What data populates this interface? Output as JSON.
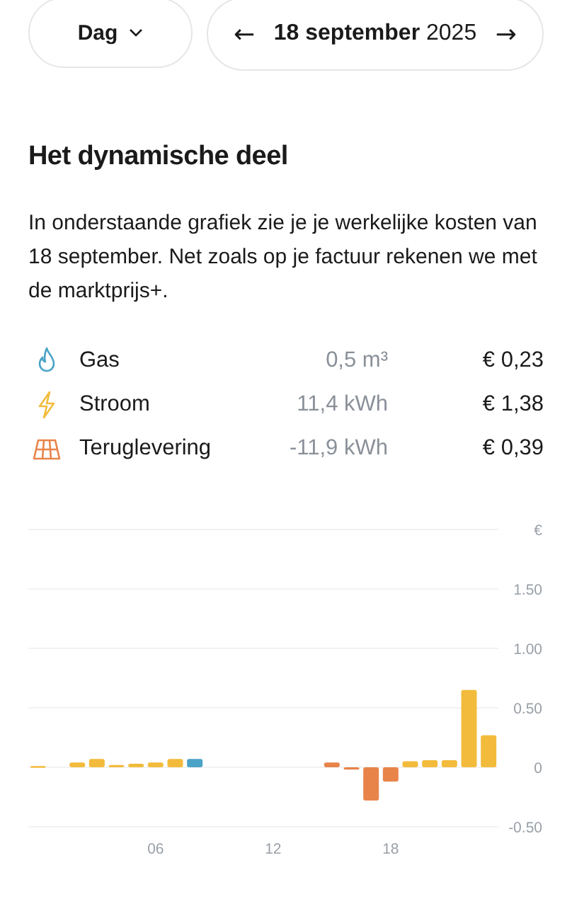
{
  "period_selector": {
    "label": "Dag"
  },
  "date_nav": {
    "date_bold": "18 september",
    "year": "2025",
    "prev": "←",
    "next": "→"
  },
  "section": {
    "title": "Het dynamische deel",
    "text": "In onderstaande grafiek zie je je werkelijke kosten van 18 september. Net zoals op je factuur rekenen we met de marktprijs+."
  },
  "costs": [
    {
      "kind": "gas",
      "name": "Gas",
      "usage": "0,5 m³",
      "cost": "€ 0,23"
    },
    {
      "kind": "stroom",
      "name": "Stroom",
      "usage": "11,4 kWh",
      "cost": "€ 1,38"
    },
    {
      "kind": "teruglevering",
      "name": "Teruglevering",
      "usage": "-11,9 kWh",
      "cost": "€ 0,39"
    }
  ],
  "chart": {
    "chart_data": {
      "type": "bar",
      "grid": true,
      "ylabel": "€",
      "xlim": [
        -0.5,
        23.5
      ],
      "x": [
        0,
        1,
        2,
        3,
        4,
        5,
        6,
        7,
        8,
        9,
        10,
        11,
        12,
        13,
        14,
        15,
        16,
        17,
        18,
        19,
        20,
        21,
        22,
        23
      ],
      "series": [
        {
          "color": "#f2bb3c",
          "values": [
            0.01,
            0,
            0.04,
            0.07,
            0.02,
            0.03,
            0.04,
            0.07,
            0,
            0,
            0,
            0,
            0,
            0,
            0,
            0,
            0,
            0,
            0,
            0.05,
            0.06,
            0.06,
            0.65,
            0.27
          ]
        },
        {
          "color": "#4aa3c6",
          "values": [
            0,
            0,
            0,
            0,
            0,
            0,
            0,
            0,
            0.07,
            0,
            0,
            0,
            0,
            0,
            0,
            0,
            0,
            0,
            0,
            0,
            0,
            0,
            0,
            0
          ]
        },
        {
          "color": "#e8844a",
          "values": [
            0,
            0,
            0,
            0,
            0,
            0,
            0,
            0,
            0,
            0,
            0,
            0,
            0,
            0,
            0,
            0.04,
            -0.02,
            -0.28,
            -0.12,
            0,
            0,
            0,
            0,
            0
          ]
        }
      ],
      "ylim": [
        -0.5,
        2.0
      ],
      "yticks": [
        {
          "value": -0.5,
          "label": "-0.50"
        },
        {
          "value": 0,
          "label": "0"
        },
        {
          "value": 0.5,
          "label": "0.50"
        },
        {
          "value": 1,
          "label": "1.00"
        },
        {
          "value": 1.5,
          "label": "1.50"
        }
      ],
      "xticks": [
        {
          "value": 6,
          "label": "06"
        },
        {
          "value": 12,
          "label": "12"
        },
        {
          "value": 18,
          "label": "18"
        }
      ]
    }
  }
}
